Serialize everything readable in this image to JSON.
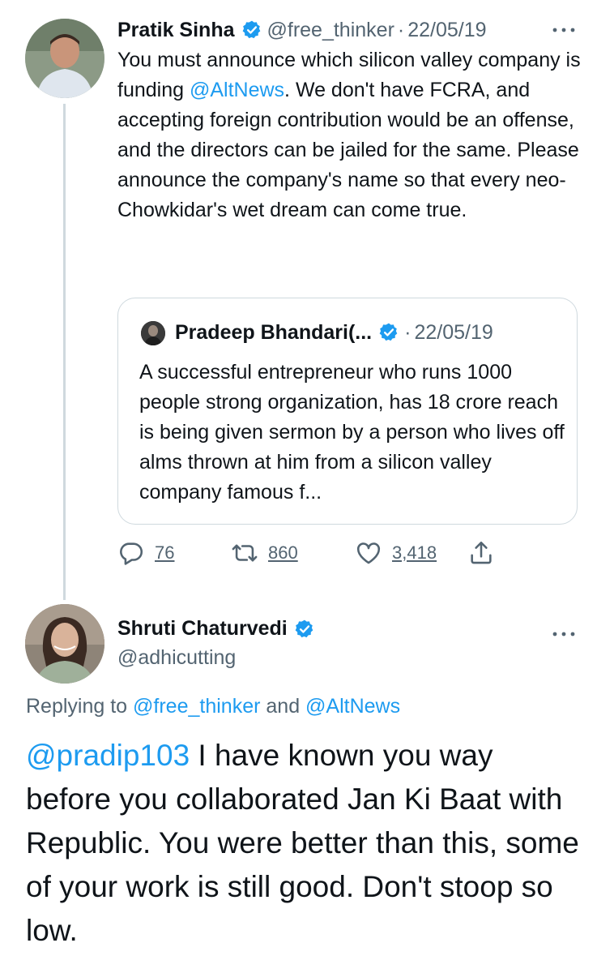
{
  "parent": {
    "name": "Pratik Sinha",
    "handle": "@free_thinker",
    "dot": "·",
    "date": "22/05/19",
    "text_a": "You must announce which silicon valley company is funding ",
    "mention": "@AltNews",
    "text_b": ". We don't have FCRA, and accepting foreign contribution would be an offense, and the directors can be jailed for the same. Please announce the company's name so that every neo-Chowkidar's wet dream can come true.",
    "quote": {
      "name": "Pradeep Bhandari(...",
      "dot": "·",
      "date": "22/05/19",
      "text": "A successful entrepreneur who runs 1000 people strong organization, has 18 crore reach is being given sermon by a person who lives off alms thrown at him from a silicon valley company famous f..."
    },
    "actions": {
      "replies": "76",
      "retweets": "860",
      "likes": "3,418"
    }
  },
  "reply": {
    "name": "Shruti Chaturvedi",
    "handle": "@adhicutting",
    "replying_prefix": "Replying to ",
    "replying_user1": "@free_thinker",
    "replying_and": " and ",
    "replying_user2": "@AltNews",
    "mention": "@pradip103",
    "text": " I have known you way before you collaborated Jan Ki Baat with Republic. You were better than this, some of your work is still good. Don't stoop so low."
  },
  "colors": {
    "link": "#1d9bf0",
    "muted": "#536471",
    "verified": "#1d9bf0",
    "text": "#0f1419"
  },
  "icons": [
    "verified-badge-icon",
    "more-icon",
    "reply-icon",
    "retweet-icon",
    "like-icon",
    "share-icon"
  ]
}
